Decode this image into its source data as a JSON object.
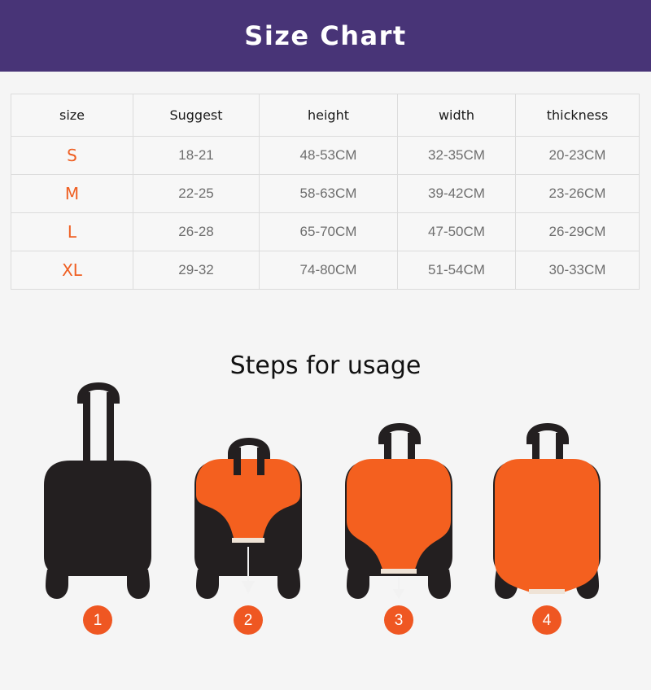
{
  "header": {
    "title": "Size Chart",
    "background_color": "#483477",
    "text_color": "#ffffff"
  },
  "table": {
    "columns": [
      "size",
      "Suggest",
      "height",
      "width",
      "thickness"
    ],
    "rows": [
      {
        "size": "S",
        "suggest": "18-21",
        "height": "48-53CM",
        "width": "32-35CM",
        "thickness": "20-23CM"
      },
      {
        "size": "M",
        "suggest": "22-25",
        "height": "58-63CM",
        "width": "39-42CM",
        "thickness": "23-26CM"
      },
      {
        "size": "L",
        "suggest": "26-28",
        "height": "65-70CM",
        "width": "47-50CM",
        "thickness": "26-29CM"
      },
      {
        "size": "XL",
        "suggest": "29-32",
        "height": "74-80CM",
        "width": "51-54CM",
        "thickness": "30-33CM"
      }
    ],
    "size_color": "#ef5f22",
    "value_color": "#6e6e6e",
    "border_color": "#dcdcdc"
  },
  "steps": {
    "title": "Steps for usage",
    "accent_color": "#ef5722",
    "luggage_color": "#231f20",
    "cover_color": "#f4601f",
    "items": [
      {
        "number": "1",
        "icon": "suitcase-uncovered-icon"
      },
      {
        "number": "2",
        "icon": "suitcase-cover-start-icon"
      },
      {
        "number": "3",
        "icon": "suitcase-cover-mid-icon"
      },
      {
        "number": "4",
        "icon": "suitcase-cover-complete-icon"
      }
    ]
  }
}
